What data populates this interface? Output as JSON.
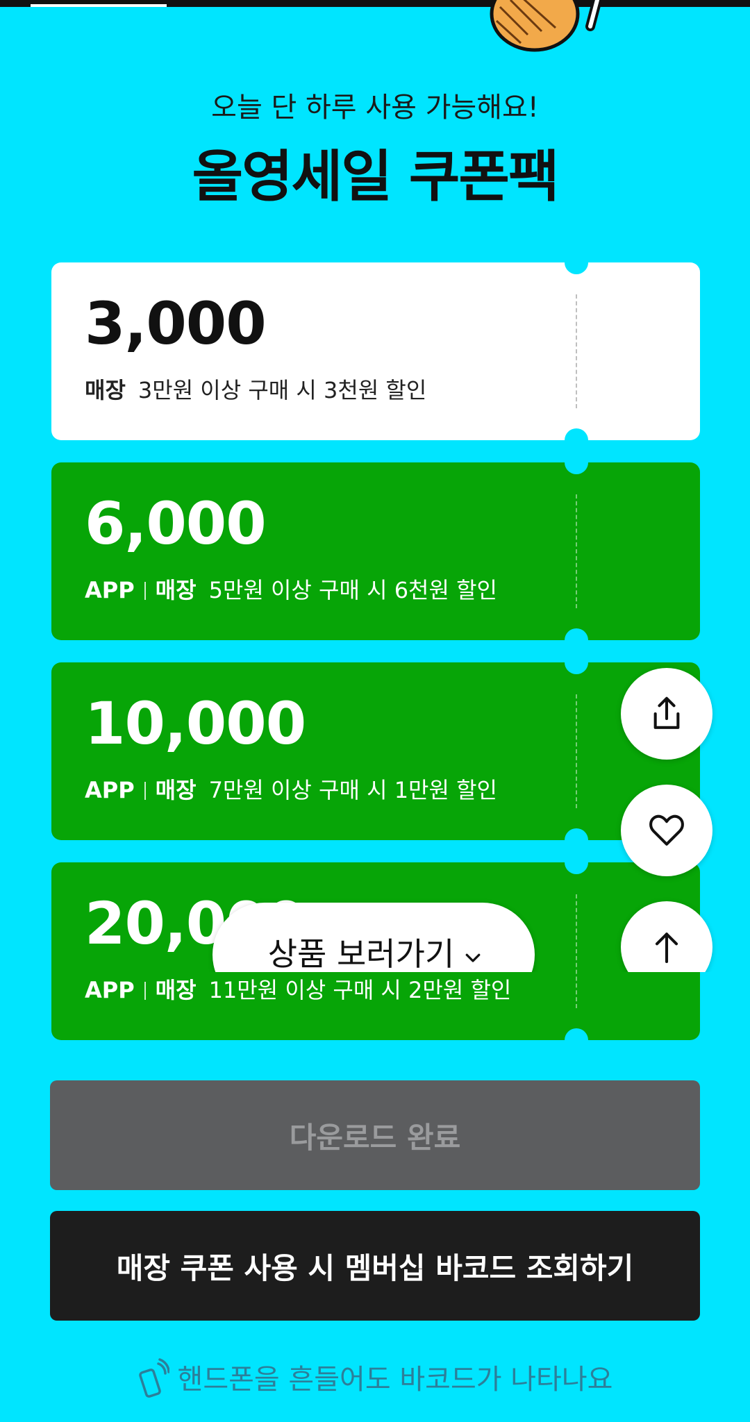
{
  "header": {
    "subtitle": "오늘 단 하루 사용 가능해요!",
    "title": "올영세일 쿠폰팩"
  },
  "coupons": [
    {
      "amount": "3,000",
      "channels": [
        "매장"
      ],
      "condition": "3만원 이상 구매 시 3천원 할인",
      "style": "white"
    },
    {
      "amount": "6,000",
      "channels": [
        "APP",
        "매장"
      ],
      "condition": "5만원 이상 구매 시 6천원 할인",
      "style": "green"
    },
    {
      "amount": "10,000",
      "channels": [
        "APP",
        "매장"
      ],
      "condition": "7만원 이상 구매 시 1만원 할인",
      "style": "green"
    },
    {
      "amount": "20,000",
      "channels": [
        "APP",
        "매장"
      ],
      "condition": "11만원 이상 구매 시 2만원 할인",
      "style": "green"
    }
  ],
  "floating": {
    "browse_label": "상품 보러가기",
    "share_icon": "share-icon",
    "heart_icon": "heart-icon",
    "top_icon": "arrow-up-icon"
  },
  "actions": {
    "download_done": "다운로드 완료",
    "barcode": "매장 쿠폰 사용 시 멤버십 바코드 조회하기"
  },
  "hint": {
    "text": "핸드폰을 흔들어도 바코드가 나타나요",
    "icon": "phone-shake-icon"
  },
  "colors": {
    "background": "#00e5ff",
    "coupon_green": "#07a507",
    "done_button": "#5c5d5f",
    "barcode_button": "#1d1d1d"
  }
}
